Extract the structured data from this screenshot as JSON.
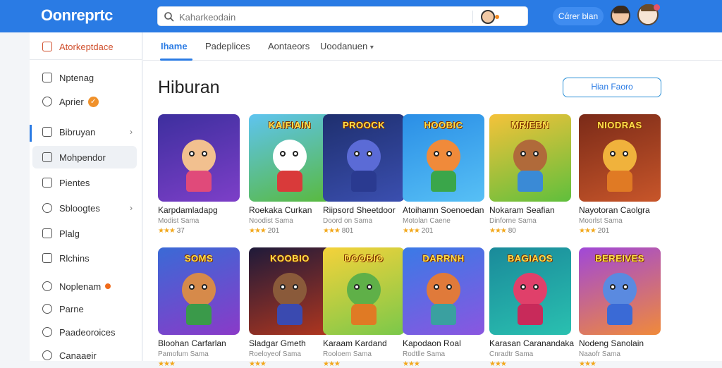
{
  "app": {
    "logo": "Oonreprtc",
    "search_placeholder": "Kaharkeodain",
    "top_button": "Cάrer blan"
  },
  "sidebar": {
    "items": [
      {
        "label": "Atorkeptdace",
        "icon": "home-icon"
      },
      {
        "label": "Nptenag",
        "icon": "lock-icon"
      },
      {
        "label": "Aprier",
        "icon": "clock-icon",
        "badge": "✓"
      },
      {
        "label": "Bibruyan",
        "icon": "grid-icon"
      },
      {
        "label": "Mohpendor",
        "icon": "edit-icon"
      },
      {
        "label": "Pientes",
        "icon": "document-icon"
      },
      {
        "label": "Sbloogtes",
        "icon": "circle-icon"
      },
      {
        "label": "Plalg",
        "icon": "square-icon"
      },
      {
        "label": "Rlchins",
        "icon": "check-icon"
      },
      {
        "label": "Noplenam",
        "icon": "mail-icon"
      },
      {
        "label": "Parne",
        "icon": "globe-icon"
      },
      {
        "label": "Paadeoroices",
        "icon": "settings-icon"
      },
      {
        "label": "Canaaeir",
        "icon": "user-icon"
      }
    ]
  },
  "tabs": [
    "Ihame",
    "Padeplices",
    "Aontaeors",
    "Uoodanuen"
  ],
  "page": {
    "title": "Hiburan",
    "action_button": "Hian Faoro"
  },
  "games": [
    {
      "name": "Karpdamladapg",
      "sub": "Modist Sama",
      "rating": "37",
      "title_art": "",
      "colors": [
        "#3d2f9e",
        "#7d3fc8"
      ],
      "char": "#f2c08f",
      "body": "#e04a7a"
    },
    {
      "name": "Roekaka Curkan",
      "sub": "Noodist Sama",
      "rating": "201",
      "title_art": "KAIFIAIN",
      "colors": [
        "#5ec4f0",
        "#59b93d"
      ],
      "char": "#ffffff",
      "body": "#d93a3a"
    },
    {
      "name": "Riipsord Sheetdoor",
      "sub": "Doord on Sama",
      "rating": "801",
      "title_art": "PROOCK",
      "colors": [
        "#1e2f6e",
        "#3b4fb0"
      ],
      "char": "#5b6bd6",
      "body": "#2a3a90"
    },
    {
      "name": "Atoihamn Soenoedan",
      "sub": "Motolan Caene",
      "rating": "201",
      "title_art": "HOOBIC",
      "colors": [
        "#2a8ee6",
        "#57c0f5"
      ],
      "char": "#f08a3a",
      "body": "#3aa64a"
    },
    {
      "name": "Nokaram Seafian",
      "sub": "Dinforne Sama",
      "rating": "80",
      "title_art": "MRIEBN",
      "colors": [
        "#f5c23a",
        "#5fbf3c"
      ],
      "char": "#b06a3a",
      "body": "#3a8ad6"
    },
    {
      "name": "Nayotoran Caolgra",
      "sub": "Moorlst Sama",
      "rating": "201",
      "title_art": "NIODRAS",
      "colors": [
        "#7a2a18",
        "#c8562a"
      ],
      "char": "#f0b23c",
      "body": "#e07a24"
    },
    {
      "name": "Bloohan Carfarlan",
      "sub": "Pamofum Sama",
      "rating": "",
      "title_art": "SOMS",
      "colors": [
        "#3a6ad6",
        "#8a3ac8"
      ],
      "char": "#d68a4a",
      "body": "#3a9a4a"
    },
    {
      "name": "Sladgar Gmeth",
      "sub": "Roeloyeof Sama",
      "rating": "",
      "title_art": "KOOBIO",
      "colors": [
        "#1e1a3a",
        "#b0361e"
      ],
      "char": "#8a5a3a",
      "body": "#3a4ab0"
    },
    {
      "name": "Karaam Kardand",
      "sub": "Rooloem Sama",
      "rating": "",
      "title_art": "DOOBIO",
      "colors": [
        "#f5d23a",
        "#7ac84a"
      ],
      "char": "#5fb048",
      "body": "#e07a24"
    },
    {
      "name": "Kapodaon Roal",
      "sub": "Rodtlle Sama",
      "rating": "",
      "title_art": "DARRNH",
      "colors": [
        "#3a7ae6",
        "#8a56e0"
      ],
      "char": "#e07a3a",
      "body": "#3aa0a0"
    },
    {
      "name": "Karasan Caranandaka",
      "sub": "Cnradtr Sama",
      "rating": "",
      "title_art": "BAGIAOS",
      "colors": [
        "#1a8a9a",
        "#2ac0b0"
      ],
      "char": "#e0406a",
      "body": "#c82a5a"
    },
    {
      "name": "Nodeng Sanolain",
      "sub": "Naaofr Sama",
      "rating": "",
      "title_art": "BEREIVES",
      "colors": [
        "#a048d8",
        "#f08a3a"
      ],
      "char": "#5a8ae0",
      "body": "#3a6ad6"
    }
  ],
  "colors": {
    "topbar": "#2a7be4",
    "accent": "#2a7be4",
    "active_red": "#d0502e",
    "badge": "#f0912b"
  }
}
